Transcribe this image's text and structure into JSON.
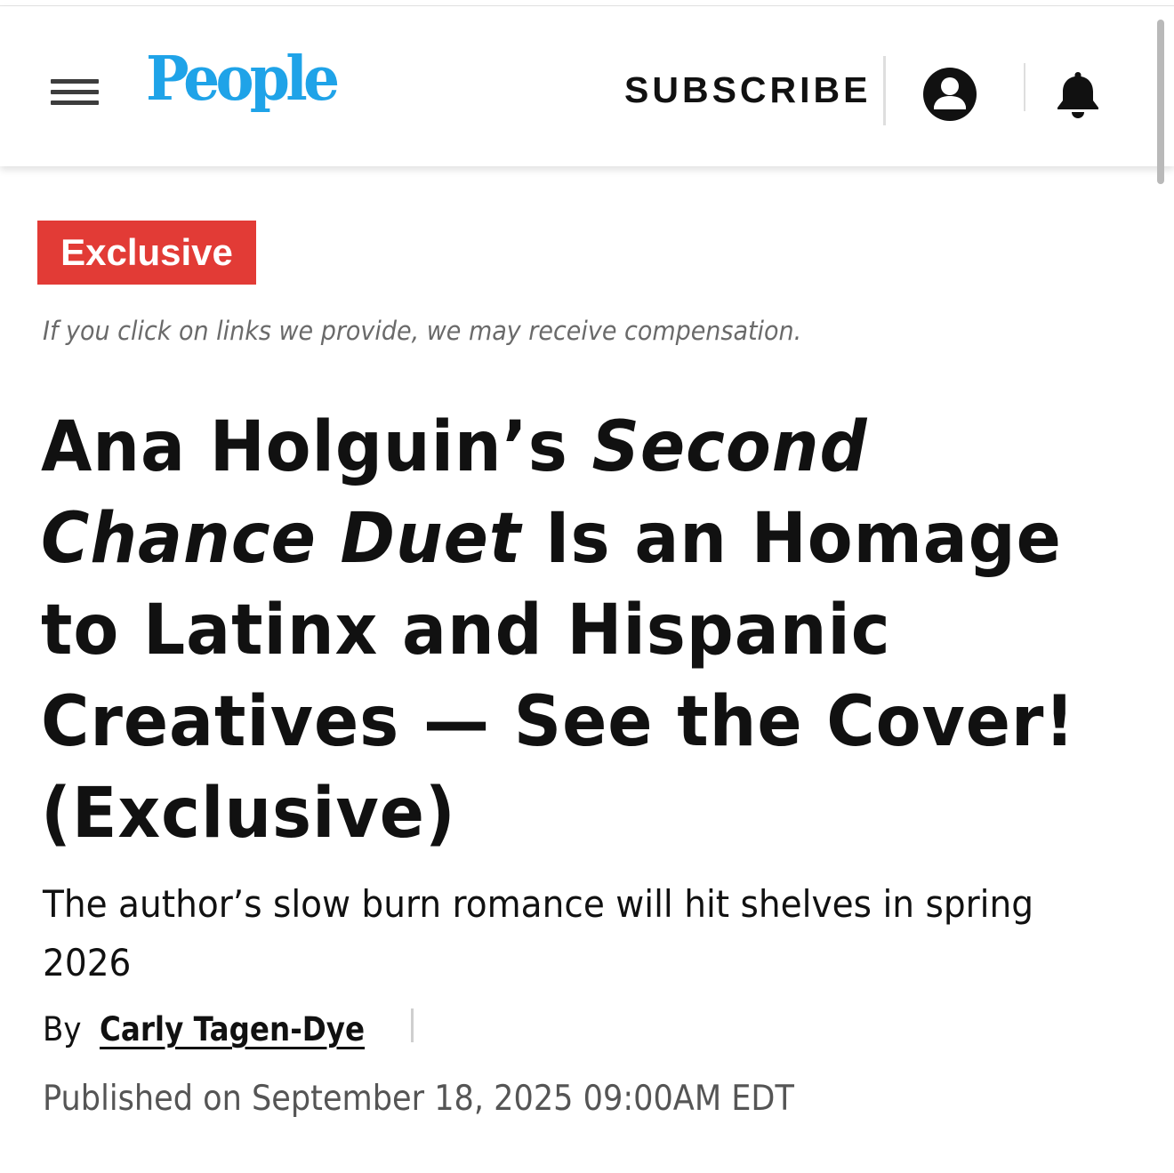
{
  "header": {
    "logo_text": "People",
    "subscribe_label": "SUBSCRIBE",
    "brand_color": "#1fa3e8",
    "icons": [
      "hamburger-menu-icon",
      "account-icon",
      "bell-icon"
    ]
  },
  "article": {
    "badge_label": "Exclusive",
    "badge_color": "#e23b36",
    "disclaimer": "If you click on links we provide, we may receive compensation.",
    "headline": {
      "line1_prefix": "Ana Holguin’s ",
      "line1_italic": "Second",
      "line2_italic": "Chance Duet",
      "line2_rest": " Is an Homage",
      "line3": "to Latinx and Hispanic",
      "line4": "Creatives — See the Cover!",
      "line5": "(Exclusive)"
    },
    "dek": {
      "line1": "The author’s slow burn romance will hit shelves in spring",
      "line2": "2026"
    },
    "byline_prefix": "By",
    "author": "Carly Tagen-Dye",
    "published": "Published on September 18, 2025 09:00AM EDT"
  }
}
